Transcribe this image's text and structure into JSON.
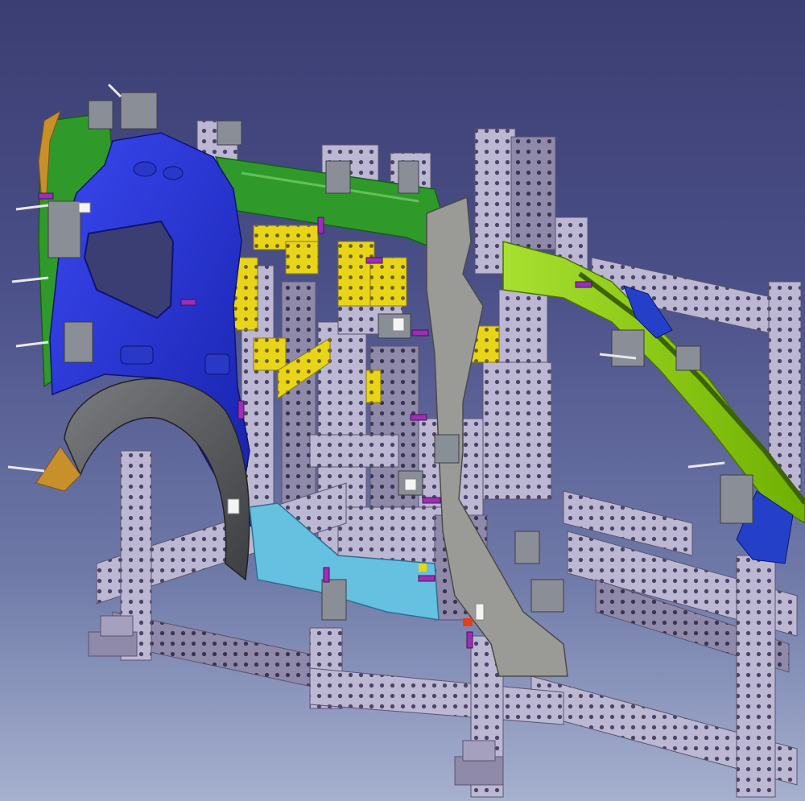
{
  "viewport": {
    "background_top": "#3b3e72",
    "background_bottom": "#a6b1cf"
  },
  "model": {
    "parts": [
      {
        "name": "rear-side-panel",
        "color": "#1f2fd0"
      },
      {
        "name": "roof-rail-front",
        "color": "#2f9a2a"
      },
      {
        "name": "roof-rail-rear",
        "color": "#8fd000"
      },
      {
        "name": "b-pillar",
        "color": "#9a9a96"
      },
      {
        "name": "wheel-arch",
        "color": "#55575a"
      },
      {
        "name": "rocker-panel",
        "color": "#66c0e0"
      },
      {
        "name": "c-pillar-flange",
        "color": "#2f9a2a"
      },
      {
        "name": "trim-edge",
        "color": "#c8902a"
      },
      {
        "name": "support-block",
        "color": "#e8d51a"
      },
      {
        "name": "end-bracket",
        "color": "#2540c8"
      }
    ],
    "fixture_color": "#b9b4cf",
    "fixture_hole_color": "#4a4466",
    "clamp_color": "#8a8e96",
    "locator_pin_color": "#9b2fb5"
  }
}
